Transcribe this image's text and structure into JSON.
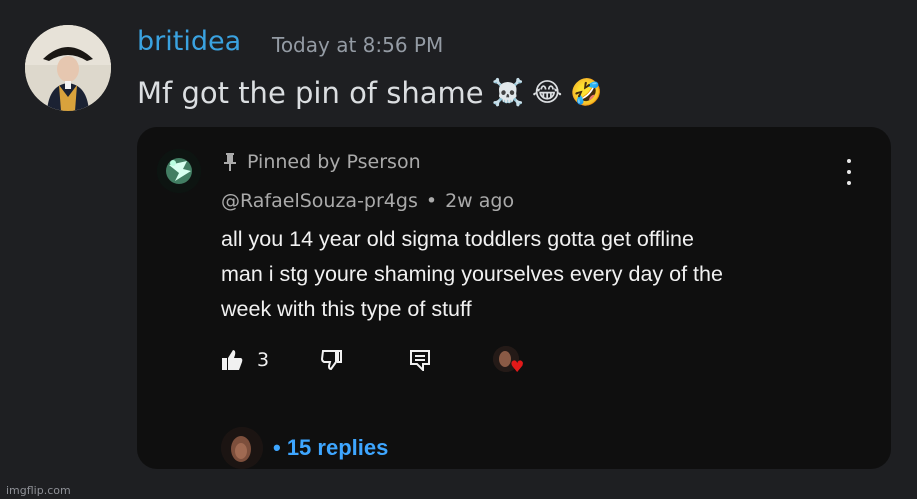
{
  "message": {
    "username": "britidea",
    "timestamp": "Today at 8:56 PM",
    "text": "Mf got the pin of shame",
    "emojis": [
      "☠️",
      "😂",
      "🤣"
    ]
  },
  "comment": {
    "pinned_label": "Pinned by Pserson",
    "handle": "@RafaelSouza-pr4gs",
    "separator": "•",
    "age": "2w ago",
    "lines": [
      "all you 14 year old sigma toddlers gotta get offline",
      "man i stg youre shaming yourselves every day of the",
      "week with this type of stuff"
    ],
    "likes": "3",
    "replies": "• 15 replies",
    "icons": [
      "pin-icon",
      "more-vertical-icon",
      "thumbs-up-icon",
      "thumbs-down-icon",
      "reply-icon",
      "heart-icon"
    ]
  },
  "watermark": "imgflip.com"
}
